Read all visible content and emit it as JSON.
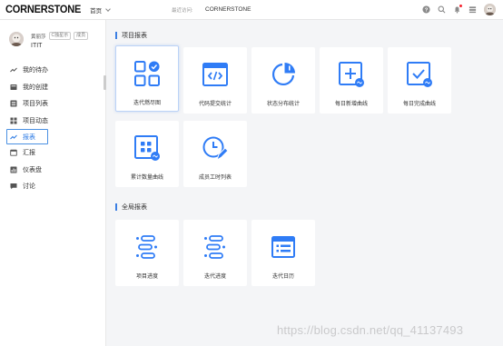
{
  "header": {
    "logo": "CORNERSTONE",
    "home": "首页",
    "recent_label": "最近访问:",
    "recent_project": "CORNERSTONE",
    "notification_dot_color": "#f5222d"
  },
  "user": {
    "name": "黄丽莎",
    "tag1": "C独星示",
    "tag2": "成员",
    "org": "ITIT"
  },
  "sidebar": {
    "items": [
      {
        "label": "我的待办",
        "icon": "trend-icon"
      },
      {
        "label": "我的创建",
        "icon": "folder-icon"
      },
      {
        "label": "项目列表",
        "icon": "list-icon"
      },
      {
        "label": "项目动态",
        "icon": "grid-icon"
      },
      {
        "label": "报表",
        "icon": "chart-line-icon",
        "active": true
      },
      {
        "label": "汇报",
        "icon": "calendar-icon"
      },
      {
        "label": "仪表盘",
        "icon": "dashboard-icon"
      },
      {
        "label": "讨论",
        "icon": "chat-icon"
      }
    ]
  },
  "sections": {
    "project_reports": "项目报表",
    "global_reports": "全局报表"
  },
  "project_cards": [
    {
      "label": "迭代燃尽图"
    },
    {
      "label": "代码提交统计"
    },
    {
      "label": "状态分布统计"
    },
    {
      "label": "每日新增曲线"
    },
    {
      "label": "每日完成曲线"
    },
    {
      "label": "累计数量曲线"
    },
    {
      "label": "成员工时列表"
    }
  ],
  "global_cards": [
    {
      "label": "项目进度"
    },
    {
      "label": "迭代进度"
    },
    {
      "label": "迭代日历"
    }
  ],
  "watermark": "https://blog.csdn.net/qq_41137493",
  "colors": {
    "accent": "#3b7ee3",
    "icon_blue": "#2f7cf6"
  }
}
